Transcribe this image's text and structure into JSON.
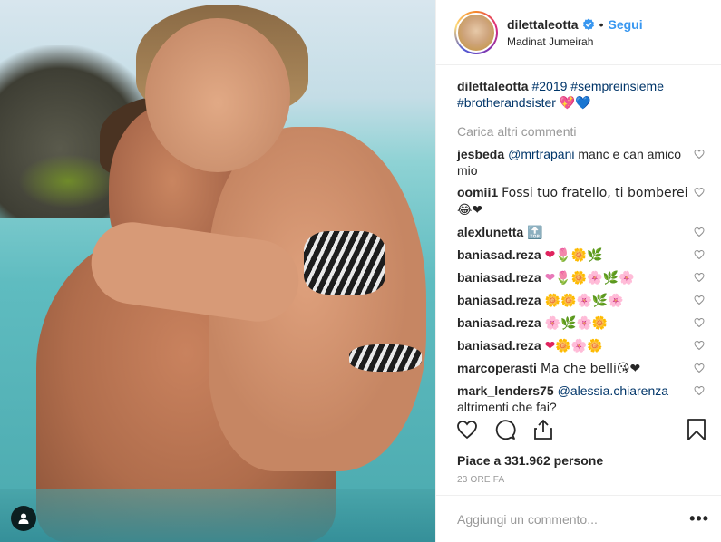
{
  "post": {
    "username": "dilettaleotta",
    "follow_label": "Segui",
    "separator": "•",
    "location": "Madinat Jumeirah"
  },
  "caption": {
    "username": "dilettaleotta",
    "tags": [
      "#2019",
      "#sempreinsieme",
      "#brotherandsister"
    ],
    "emoji": "💖💙"
  },
  "load_more_label": "Carica altri commenti",
  "comments": [
    {
      "user": "jesbeda",
      "mention": "@mrtrapani",
      "text": " manc e can amico mio"
    },
    {
      "user": "oomii1",
      "mention": "",
      "text": "Fossi tuo fratello, ti bomberei 😂❤"
    },
    {
      "user": "alexlunetta",
      "mention": "",
      "text": "🔝"
    },
    {
      "user": "baniasad.reza",
      "mention": "",
      "text": "❤🌷🌼🌿"
    },
    {
      "user": "baniasad.reza",
      "mention": "",
      "text": "❤🌷🌼🌸🌿🌸"
    },
    {
      "user": "baniasad.reza",
      "mention": "",
      "text": "🌼🌼🌸🌿🌸"
    },
    {
      "user": "baniasad.reza",
      "mention": "",
      "text": "🌸🌿🌸🌼"
    },
    {
      "user": "baniasad.reza",
      "mention": "",
      "text": "❤🌼🌸🌼"
    },
    {
      "user": "marcoperasti",
      "mention": "",
      "text": "Ma che belli😘❤"
    },
    {
      "user": "mark_lenders75",
      "mention": "@alessia.chiarenza",
      "text": " altrimenti che fai?"
    }
  ],
  "likes_text": "Piace a 331.962 persone",
  "time_text": "23 ORE FA",
  "add_comment_placeholder": "Aggiungi un commento...",
  "more_label": "•••",
  "icons": [
    "heart-icon",
    "comment-icon",
    "share-icon",
    "bookmark-icon",
    "verified-icon",
    "user-tag-icon",
    "more-icon"
  ],
  "colors": {
    "link": "#3897f0",
    "hashtag": "#003569",
    "verified": "#3897f0",
    "muted": "#999999",
    "text": "#262626"
  }
}
